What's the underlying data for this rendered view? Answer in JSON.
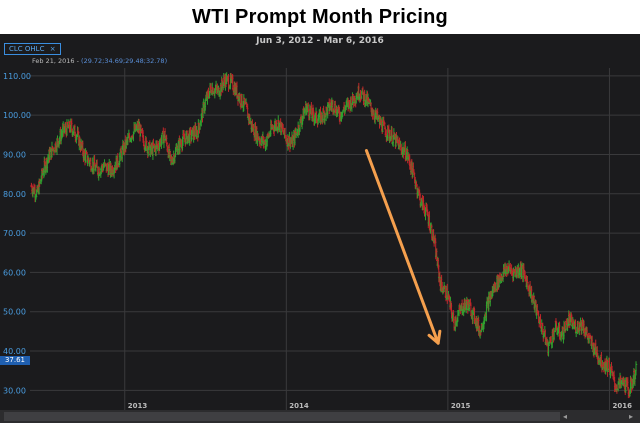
{
  "title": "WTI Prompt Month Pricing",
  "header": {
    "date_range": "Jun 3, 2012 - Mar 6, 2016",
    "series_tag": "CLC OHLC",
    "info_date": "Feb 21, 2016",
    "info_ohlc": "(29.72;34.69;29.48;32.78)",
    "last_value": "37.61"
  },
  "colors": {
    "background": "#1b1b1d",
    "grid": "#3a3a3c",
    "up": "#2fa12f",
    "down": "#c0262a",
    "axis_text": "#4a9de0",
    "arrow": "#f5a04e"
  },
  "chart_data": {
    "type": "ohlc",
    "title": "WTI Prompt Month Pricing",
    "subtitle": "Jun 3, 2012 - Mar 6, 2016",
    "xlabel": "",
    "ylabel": "",
    "ylim": [
      25,
      112
    ],
    "y_ticks": [
      30,
      40,
      50,
      60,
      70,
      80,
      90,
      100,
      110
    ],
    "y_tick_labels": [
      "30.00",
      "40.00",
      "50.00",
      "60.00",
      "70.00",
      "80.00",
      "90.00",
      "100.00",
      "110.00"
    ],
    "x_ticks": [
      {
        "label": "2013",
        "x": "2013-01-01"
      },
      {
        "label": "2014",
        "x": "2014-01-01"
      },
      {
        "label": "2015",
        "x": "2015-01-01"
      },
      {
        "label": "2016",
        "x": "2016-01-01"
      }
    ],
    "grid": true,
    "series": [
      {
        "approx_weekly_close": {
          "x": [
            "2012-06-03",
            "2012-06-17",
            "2012-07-01",
            "2012-07-15",
            "2012-08-01",
            "2012-08-15",
            "2012-09-01",
            "2012-09-15",
            "2012-10-01",
            "2012-10-15",
            "2012-11-01",
            "2012-11-15",
            "2012-12-01",
            "2012-12-15",
            "2013-01-01",
            "2013-01-15",
            "2013-02-01",
            "2013-02-15",
            "2013-03-01",
            "2013-03-15",
            "2013-04-01",
            "2013-04-15",
            "2013-05-01",
            "2013-05-15",
            "2013-06-01",
            "2013-06-15",
            "2013-07-01",
            "2013-07-15",
            "2013-08-01",
            "2013-08-15",
            "2013-09-01",
            "2013-09-15",
            "2013-10-01",
            "2013-10-15",
            "2013-11-01",
            "2013-11-15",
            "2013-12-01",
            "2013-12-15",
            "2014-01-01",
            "2014-01-15",
            "2014-02-01",
            "2014-02-15",
            "2014-03-01",
            "2014-03-15",
            "2014-04-01",
            "2014-04-15",
            "2014-05-01",
            "2014-05-15",
            "2014-06-01",
            "2014-06-15",
            "2014-07-01",
            "2014-07-15",
            "2014-08-01",
            "2014-08-15",
            "2014-09-01",
            "2014-09-15",
            "2014-10-01",
            "2014-10-15",
            "2014-11-01",
            "2014-11-15",
            "2014-12-01",
            "2014-12-15",
            "2015-01-01",
            "2015-01-15",
            "2015-02-01",
            "2015-02-15",
            "2015-03-01",
            "2015-03-15",
            "2015-04-01",
            "2015-04-15",
            "2015-05-01",
            "2015-05-15",
            "2015-06-01",
            "2015-06-15",
            "2015-07-01",
            "2015-07-15",
            "2015-08-01",
            "2015-08-15",
            "2015-09-01",
            "2015-09-15",
            "2015-10-01",
            "2015-10-15",
            "2015-11-01",
            "2015-11-15",
            "2015-12-01",
            "2015-12-15",
            "2016-01-01",
            "2016-01-15",
            "2016-02-01",
            "2016-02-15",
            "2016-03-01"
          ],
          "close": [
            82,
            80,
            86,
            90,
            93,
            96,
            97,
            95,
            90,
            88,
            86,
            87,
            86,
            88,
            92,
            95,
            97,
            93,
            91,
            92,
            95,
            88,
            92,
            94,
            95,
            96,
            103,
            107,
            106,
            109,
            108,
            105,
            102,
            97,
            94,
            93,
            97,
            98,
            94,
            93,
            98,
            102,
            100,
            99,
            101,
            103,
            100,
            102,
            104,
            106,
            104,
            101,
            98,
            96,
            94,
            92,
            90,
            85,
            78,
            75,
            68,
            57,
            54,
            47,
            51,
            52,
            49,
            45,
            52,
            56,
            59,
            61,
            60,
            61,
            57,
            52,
            46,
            41,
            46,
            44,
            48,
            46,
            47,
            43,
            40,
            37,
            36,
            31,
            32,
            30,
            35
          ]
        }
      }
    ],
    "annotations": [
      {
        "type": "arrow",
        "color": "#f5a04e",
        "from": {
          "x": "2014-07-01",
          "y": 91
        },
        "to": {
          "x": "2014-12-10",
          "y": 42
        }
      }
    ]
  }
}
